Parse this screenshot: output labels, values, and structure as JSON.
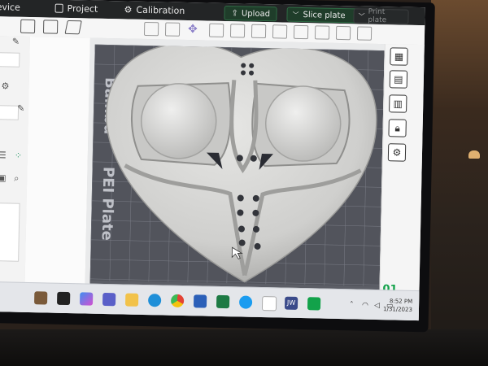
{
  "titlebar": {
    "device_label": "evice",
    "project_label": "Project",
    "calibration_label": "Calibration",
    "upload_label": "Upload",
    "slice_label": "Slice plate",
    "print_label": "Print plate"
  },
  "viewport": {
    "plate_label": "Bambu Textured PEI Plate",
    "plate_label_visible_1": "Bambu",
    "plate_label_visible_2": "PEI Plate",
    "plate_number": "01"
  },
  "taskbar": {
    "time": "8:52 PM",
    "date": "1/31/2023",
    "apps": [
      "file-explorer",
      "copilot",
      "teams",
      "folder",
      "edge",
      "chrome",
      "word",
      "excel",
      "messenger",
      "xbox",
      "jw",
      "bambu-studio"
    ]
  },
  "colors": {
    "accent_green": "#12a24a",
    "titlebar_bg": "#232526",
    "plate_grid": "#50525a"
  }
}
